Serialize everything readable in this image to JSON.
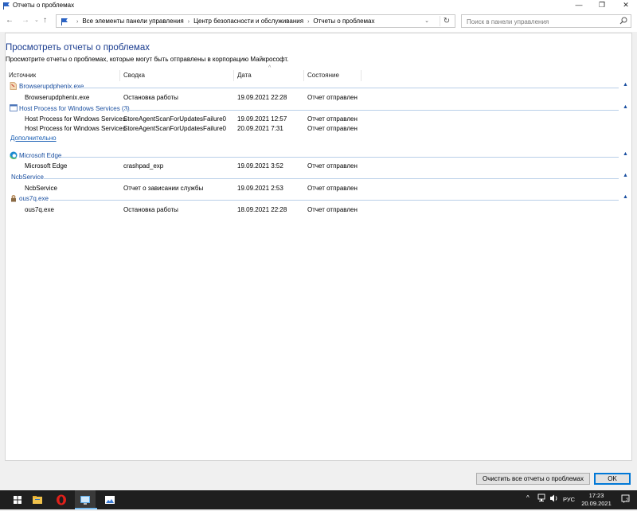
{
  "window": {
    "title": "Отчеты о проблемах",
    "controls": {
      "minimize": "—",
      "maximize": "❐",
      "close": "✕"
    }
  },
  "address_bar": {
    "breadcrumbs": [
      "Все элементы панели управления",
      "Центр безопасности и обслуживания",
      "Отчеты о проблемах"
    ],
    "separator": "›"
  },
  "search": {
    "placeholder": "Поиск в панели управления"
  },
  "page": {
    "title": "Просмотреть отчеты о проблемах",
    "description": "Просмотрите отчеты о проблемах, которые могут быть отправлены в корпорацию Майкрософт."
  },
  "table": {
    "columns": [
      "Источник",
      "Сводка",
      "Дата",
      "Состояние"
    ],
    "groups": [
      {
        "label": "Browserupdphenix.exe",
        "icon": "app-icon",
        "rows": [
          {
            "source": "Browserupdphenix.exe",
            "summary": "Остановка работы",
            "date": "19.09.2021 22:28",
            "state": "Отчет отправлен"
          }
        ]
      },
      {
        "label": "Host Process for Windows Services (3)",
        "icon": "window-icon",
        "rows": [
          {
            "source": "Host Process for Windows Services",
            "summary": "StoreAgentScanForUpdatesFailure0",
            "date": "19.09.2021 12:57",
            "state": "Отчет отправлен"
          },
          {
            "source": "Host Process for Windows Services",
            "summary": "StoreAgentScanForUpdatesFailure0",
            "date": "20.09.2021 7:31",
            "state": "Отчет отправлен"
          }
        ],
        "more_link": "Дополнительно"
      },
      {
        "label": "Microsoft Edge",
        "icon": "edge-icon",
        "rows": [
          {
            "source": "Microsoft Edge",
            "summary": "crashpad_exp",
            "date": "19.09.2021 3:52",
            "state": "Отчет отправлен"
          }
        ]
      },
      {
        "label": "NcbService",
        "icon": "",
        "rows": [
          {
            "source": "NcbService",
            "summary": "Отчет о зависании службы",
            "date": "19.09.2021 2:53",
            "state": "Отчет отправлен"
          }
        ]
      },
      {
        "label": "ous7q.exe",
        "icon": "executable-icon",
        "rows": [
          {
            "source": "ous7q.exe",
            "summary": "Остановка работы",
            "date": "18.09.2021 22:28",
            "state": "Отчет отправлен"
          }
        ]
      }
    ]
  },
  "buttons": {
    "clear_all": "Очистить все отчеты о проблемах",
    "ok": "OK"
  },
  "taskbar": {
    "language": "РУС",
    "time": "17:23",
    "date": "20.09.2021",
    "notifications": "2",
    "active_accent": "#76b9ed"
  },
  "colors": {
    "link": "#1a4fa0",
    "title": "#1a3c8f",
    "taskbar": "#1f1f1f"
  }
}
